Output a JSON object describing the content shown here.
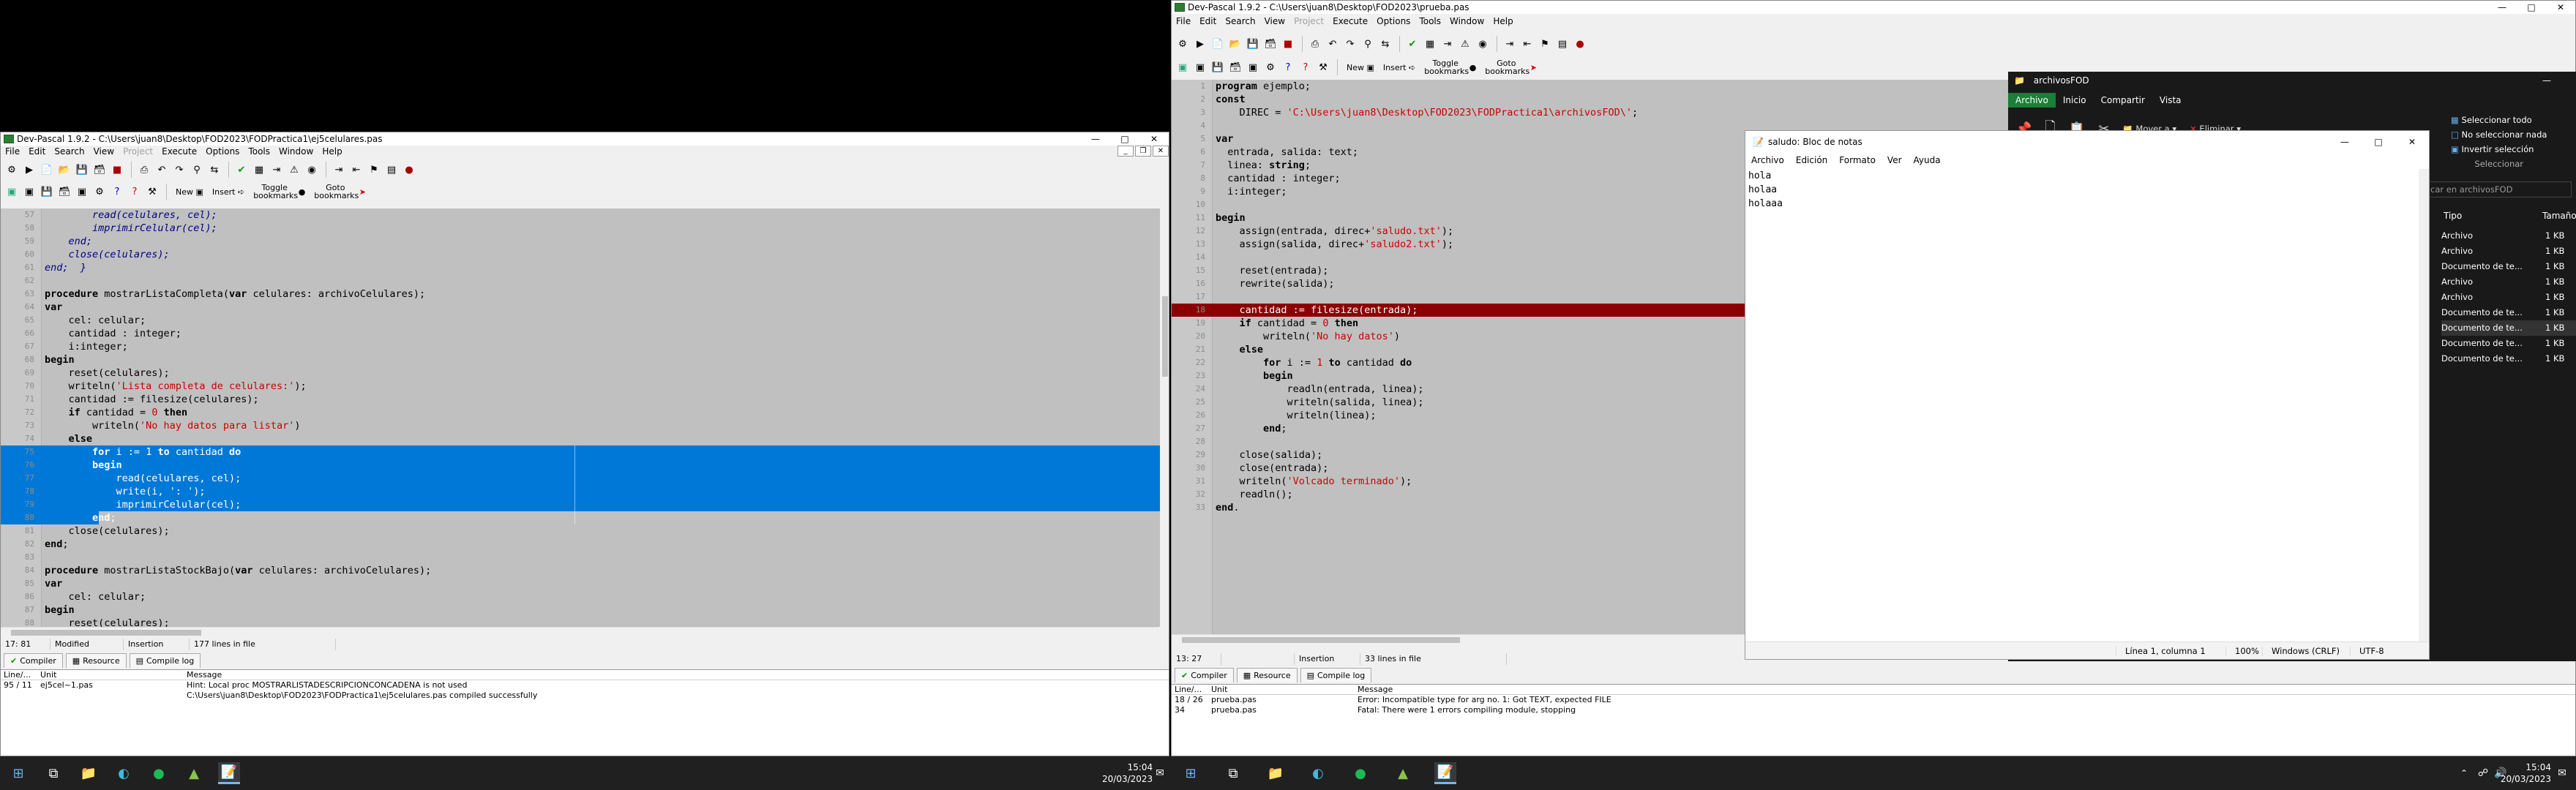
{
  "left_window": {
    "title": "Dev-Pascal 1.9.2 - C:\\Users\\juan8\\Desktop\\FOD2023\\FODPractica1\\ej5celulares.pas",
    "menu": [
      "File",
      "Edit",
      "Search",
      "View",
      "Project",
      "Execute",
      "Options",
      "Tools",
      "Window",
      "Help"
    ],
    "toolbar": {
      "new": "New",
      "insert": "Insert",
      "toggle_bookmarks": "Toggle bookmarks",
      "goto_bookmarks": "Goto bookmarks"
    },
    "status": {
      "position": "17: 81",
      "modified": "Modified",
      "mode": "Insertion",
      "lines": "177 lines in file"
    },
    "tabs": [
      "Compiler",
      "Resource",
      "Compile log"
    ],
    "messages_header": [
      "Line/...",
      "Unit",
      "Message"
    ],
    "messages": [
      {
        "line": "95 / 11",
        "unit": "ej5cel~1.pas",
        "message": "Hint: Local proc MOSTRARLISTADESCRIPCIONCONCADENA is not used"
      },
      {
        "line": "",
        "unit": "",
        "message": "C:\\Users\\juan8\\Desktop\\FOD2023\\FODPractica1\\ej5celulares.pas compiled successfully"
      }
    ]
  },
  "right_window": {
    "title": "Dev-Pascal 1.9.2 - C:\\Users\\juan8\\Desktop\\FOD2023\\prueba.pas",
    "menu": [
      "File",
      "Edit",
      "Search",
      "View",
      "Project",
      "Execute",
      "Options",
      "Tools",
      "Window",
      "Help"
    ],
    "toolbar": {
      "new": "New",
      "insert": "Insert",
      "toggle_bookmarks": "Toggle bookmarks",
      "goto_bookmarks": "Goto bookmarks"
    },
    "status": {
      "position": "13: 27",
      "modified": "",
      "mode": "Insertion",
      "lines": "33 lines in file"
    },
    "tabs": [
      "Compiler",
      "Resource",
      "Compile log"
    ],
    "messages_header": [
      "Line/...",
      "Unit",
      "Message"
    ],
    "messages": [
      {
        "line": "18 / 26",
        "unit": "prueba.pas",
        "message": "Error: Incompatible type for arg no. 1: Got TEXT, expected FILE"
      },
      {
        "line": "34",
        "unit": "prueba.pas",
        "message": "Fatal: There were 1 errors compiling module, stopping"
      }
    ]
  },
  "notepad": {
    "title": "saludo: Bloc de notas",
    "menu": [
      "Archivo",
      "Edición",
      "Formato",
      "Ver",
      "Ayuda"
    ],
    "content": "hola\nholaa\nholaaa",
    "status": {
      "position": "Línea 1, columna 1",
      "zoom": "100%",
      "eol": "Windows (CRLF)",
      "encoding": "UTF-8"
    }
  },
  "explorer": {
    "title": "archivosFOD",
    "ribbon_tabs": [
      "Archivo",
      "Inicio",
      "Compartir",
      "Vista"
    ],
    "move_to": "Mover a",
    "delete": "Eliminar",
    "select_all": "Seleccionar todo",
    "select_none": "No seleccionar nada",
    "invert_selection": "Invertir selección",
    "select_group": "Seleccionar",
    "search_placeholder": "car en archivosFOD",
    "columns": [
      "Tipo",
      "Tamaño"
    ],
    "rows": [
      {
        "type": "Archivo",
        "size": "1 KB"
      },
      {
        "type": "Archivo",
        "size": "1 KB"
      },
      {
        "type": "Documento de te...",
        "size": "1 KB"
      },
      {
        "type": "Archivo",
        "size": "1 KB"
      },
      {
        "type": "Archivo",
        "size": "1 KB"
      },
      {
        "type": "Documento de te...",
        "size": "1 KB"
      },
      {
        "type": "Documento de te...",
        "size": "1 KB"
      },
      {
        "type": "Documento de te...",
        "size": "1 KB"
      },
      {
        "type": "Documento de te...",
        "size": "1 KB"
      }
    ]
  },
  "taskbar_left": {
    "time": "15:04",
    "date": "20/03/2023"
  },
  "taskbar_right": {
    "time": "15:04",
    "date": "20/03/2023"
  },
  "colors": {
    "selection": "#0078d7",
    "error_line": "#8b0000",
    "editor_bg": "#c0c0c0",
    "taskbar": "#202020"
  }
}
